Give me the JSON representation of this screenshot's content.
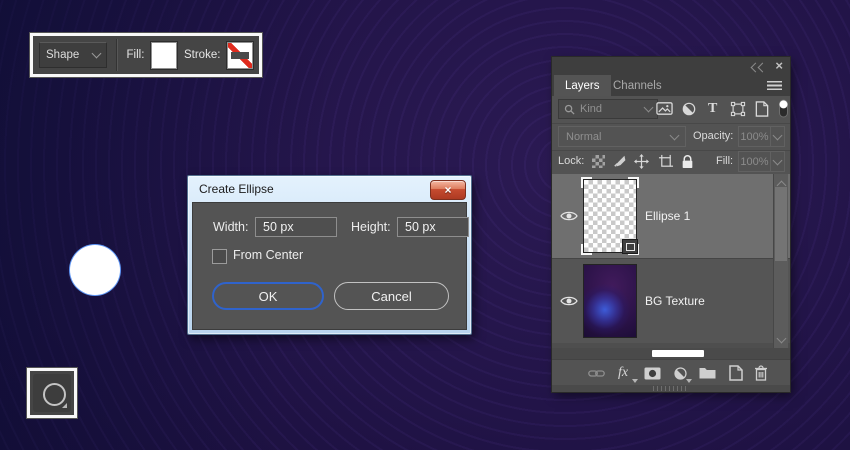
{
  "options_bar": {
    "tool_mode": "Shape",
    "fill_label": "Fill:",
    "stroke_label": "Stroke:"
  },
  "tool_button": {
    "tool": "Ellipse Tool"
  },
  "dialog": {
    "title": "Create Ellipse",
    "width_label": "Width:",
    "width_value": "50 px",
    "height_label": "Height:",
    "height_value": "50 px",
    "from_center_label": "From Center",
    "from_center_checked": false,
    "ok_label": "OK",
    "cancel_label": "Cancel"
  },
  "layers_panel": {
    "collapse_glyph": "",
    "close_glyph": "×",
    "tabs": [
      {
        "label": "Layers"
      },
      {
        "label": "Channels"
      }
    ],
    "filter": {
      "kind_label": "Kind"
    },
    "blend": {
      "mode": "Normal",
      "opacity_label": "Opacity:",
      "opacity_value": "100%"
    },
    "lock": {
      "label": "Lock:",
      "fill_label": "Fill:",
      "fill_value": "100%"
    },
    "layers": [
      {
        "name": "Ellipse 1",
        "selected": true,
        "type": "shape"
      },
      {
        "name": "BG Texture",
        "selected": false,
        "type": "image"
      }
    ]
  },
  "colors": {
    "accent_blue": "#2f63cc",
    "panel_bg": "#535353",
    "selected_row": "#6f6f6f",
    "canvas_base": "#1c1243",
    "stroke_none_red": "#df2b1e",
    "dialog_close_red": "#c4462c",
    "ellipse_fill": "#ffffff"
  }
}
